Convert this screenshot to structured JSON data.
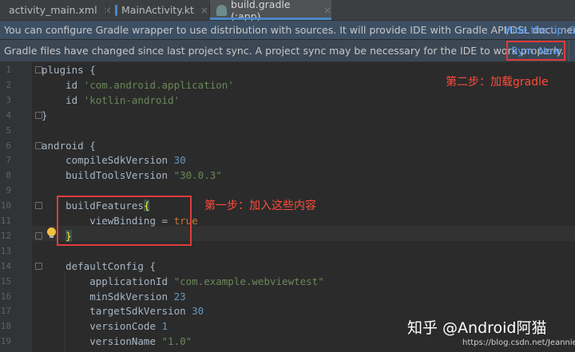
{
  "tabs": [
    {
      "label": "activity_main.xml",
      "close": "×",
      "icon": "xml-file-icon",
      "color": "#e8904a"
    },
    {
      "label": "MainActivity.kt",
      "close": "×",
      "icon": "kotlin-file-icon",
      "color": "#4a88c7"
    },
    {
      "label": "build.gradle (:app)",
      "close": "×",
      "icon": "gradle-file-icon",
      "color": "#6c8c8c"
    }
  ],
  "banner_wrapper": {
    "message": "You can configure Gradle wrapper to use distribution with sources. It will provide IDE with Gradle API/DSL document",
    "hide_link": "Hide the tip",
    "more_link": "G"
  },
  "banner_sync": {
    "message": "Gradle files have changed since last project sync. A project sync may be necessary for the IDE to work properly.",
    "sync_label": "Sync Now"
  },
  "code_lines": [
    {
      "n": "1",
      "parts": [
        [
          "t",
          "plugins {"
        ]
      ]
    },
    {
      "n": "2",
      "parts": [
        [
          "t",
          "    id "
        ],
        [
          "s",
          "'com.android.application'"
        ]
      ]
    },
    {
      "n": "3",
      "parts": [
        [
          "t",
          "    id "
        ],
        [
          "s",
          "'kotlin-android'"
        ]
      ]
    },
    {
      "n": "4",
      "parts": [
        [
          "t",
          "}"
        ]
      ]
    },
    {
      "n": "5",
      "parts": []
    },
    {
      "n": "6",
      "parts": [
        [
          "t",
          "android {"
        ]
      ]
    },
    {
      "n": "7",
      "parts": [
        [
          "t",
          "    compileSdkVersion "
        ],
        [
          "n",
          "30"
        ]
      ]
    },
    {
      "n": "8",
      "parts": [
        [
          "t",
          "    buildToolsVersion "
        ],
        [
          "s",
          "\"30.0.3\""
        ]
      ]
    },
    {
      "n": "9",
      "parts": []
    },
    {
      "n": "10",
      "parts": [
        [
          "t",
          "    buildFeatures"
        ],
        [
          "b",
          "{"
        ]
      ]
    },
    {
      "n": "11",
      "parts": [
        [
          "t",
          "        viewBinding = "
        ],
        [
          "k",
          "true"
        ]
      ]
    },
    {
      "n": "12",
      "parts": [
        [
          "t",
          "    "
        ],
        [
          "b",
          "}"
        ]
      ]
    },
    {
      "n": "13",
      "parts": []
    },
    {
      "n": "14",
      "parts": [
        [
          "t",
          "    defaultConfig {"
        ]
      ]
    },
    {
      "n": "15",
      "parts": [
        [
          "t",
          "        applicationId "
        ],
        [
          "s",
          "\"com.example.webviewtest\""
        ]
      ]
    },
    {
      "n": "16",
      "parts": [
        [
          "t",
          "        minSdkVersion "
        ],
        [
          "n",
          "23"
        ]
      ]
    },
    {
      "n": "17",
      "parts": [
        [
          "t",
          "        targetSdkVersion "
        ],
        [
          "n",
          "30"
        ]
      ]
    },
    {
      "n": "18",
      "parts": [
        [
          "t",
          "        versionCode "
        ],
        [
          "n",
          "1"
        ]
      ]
    },
    {
      "n": "19",
      "parts": [
        [
          "t",
          "        versionName "
        ],
        [
          "s",
          "\"1.0\""
        ]
      ]
    }
  ],
  "annotations": {
    "step1": "第一步：加入这些内容",
    "step2": "第二步：加载gradle"
  },
  "watermark": {
    "main": "知乎 @Android阿猫",
    "url": "https://blog.csdn.net/Jeannie2"
  },
  "colors": {
    "annotation_red": "#ff4b3a",
    "link_blue": "#589df6",
    "keyword_orange": "#cc7832",
    "string_green": "#6a8759",
    "number_blue": "#6897bb"
  }
}
